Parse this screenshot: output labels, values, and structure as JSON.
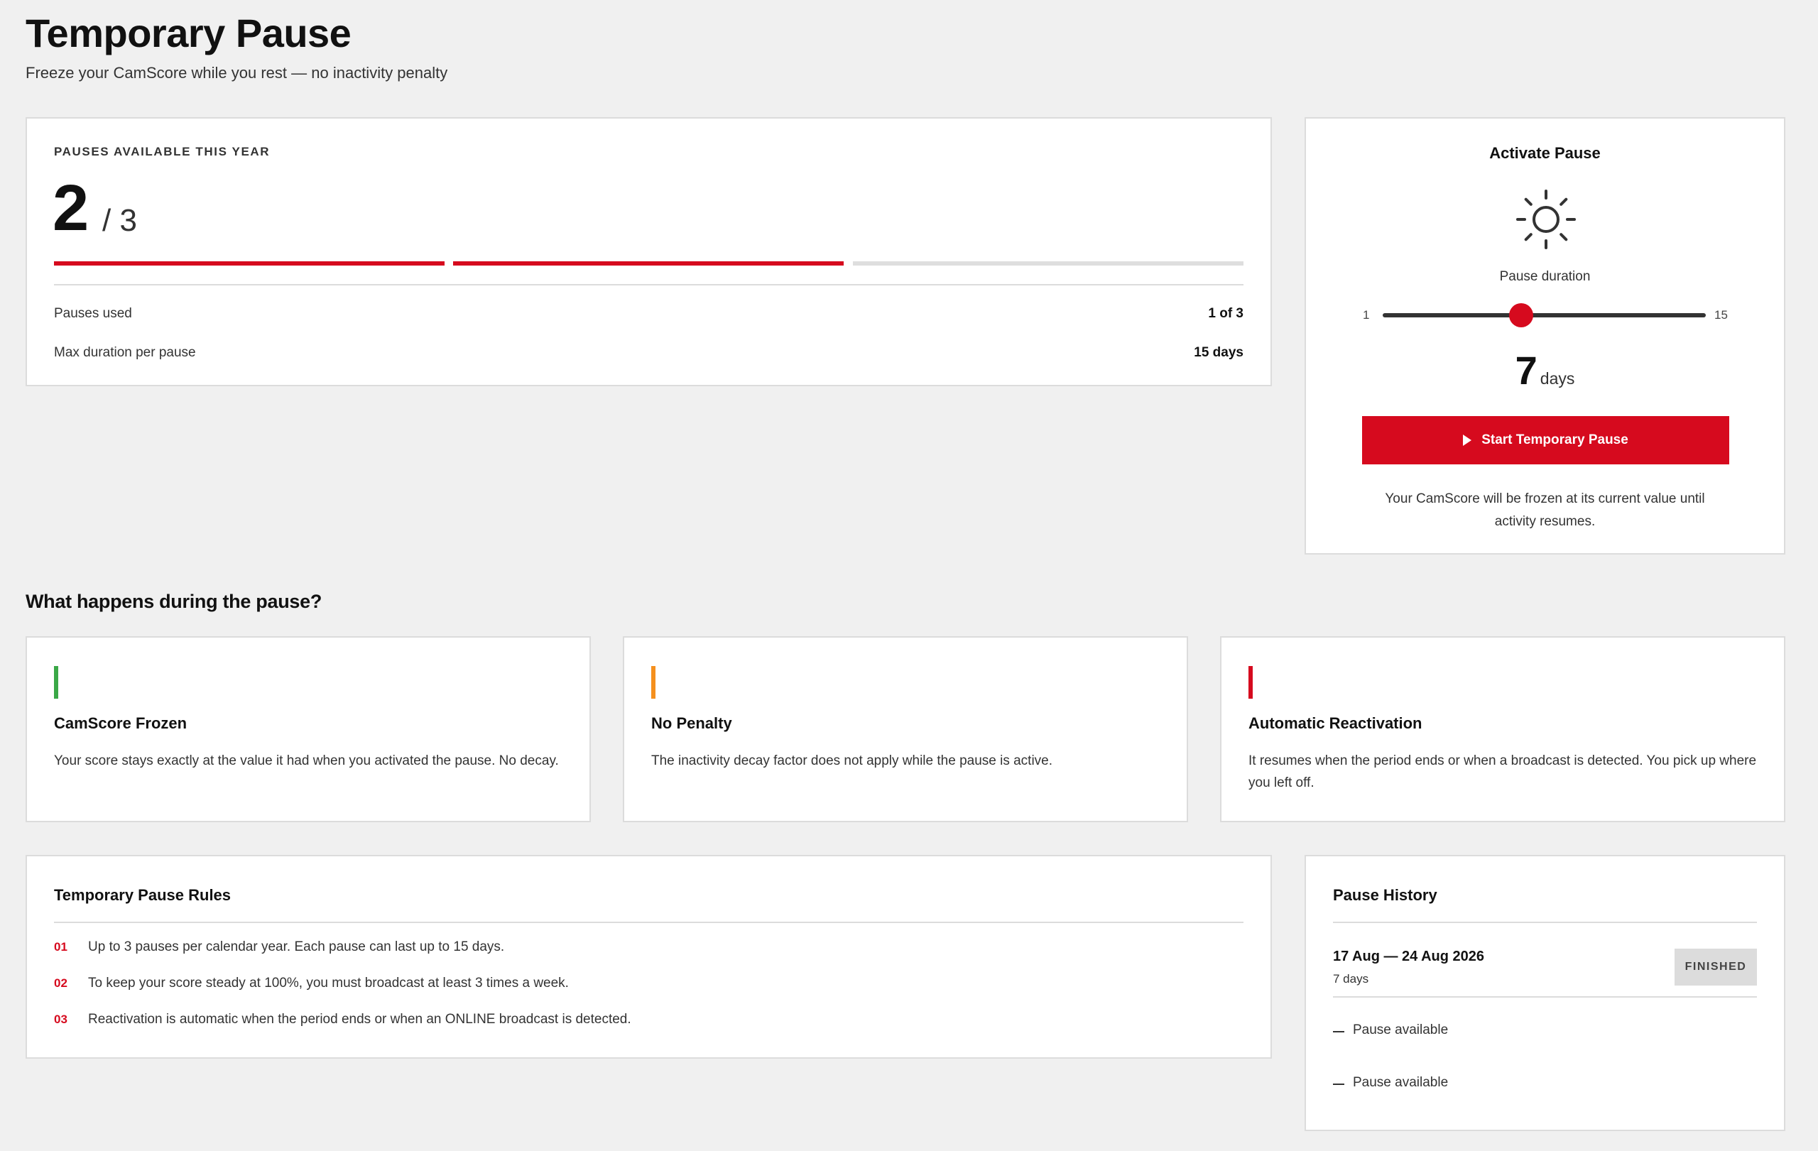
{
  "header": {
    "title": "Temporary Pause",
    "subtitle": "Freeze your CamScore while you rest — no inactivity penalty"
  },
  "availability": {
    "eyebrow": "PAUSES AVAILABLE THIS YEAR",
    "available": "2",
    "total": "/ 3",
    "segments_filled": 2,
    "segments_total": 3,
    "stats": [
      {
        "label": "Pauses used",
        "value": "1 of 3"
      },
      {
        "label": "Max duration per pause",
        "value": "15 days"
      }
    ]
  },
  "activate": {
    "title": "Activate Pause",
    "icon": "sun-icon",
    "duration_label": "Pause duration",
    "slider_min": "1",
    "slider_max": "15",
    "slider_value": 7,
    "days_number": "7",
    "days_unit": "days",
    "button_label": "Start Temporary Pause",
    "note": "Your CamScore will be frozen at its current value until activity resumes."
  },
  "what_happens": {
    "heading": "What happens during the pause?",
    "cards": [
      {
        "title": "CamScore Frozen",
        "desc": "Your score stays exactly at the value it had when you activated the pause. No decay.",
        "accent": "#3aa847"
      },
      {
        "title": "No Penalty",
        "desc": "The inactivity decay factor does not apply while the pause is active.",
        "accent": "#f5901e"
      },
      {
        "title": "Automatic Reactivation",
        "desc": "It resumes when the period ends or when a broadcast is detected. You pick up where you left off.",
        "accent": "#d60a1e"
      }
    ]
  },
  "rules": {
    "title": "Temporary Pause Rules",
    "items": [
      {
        "num": "01",
        "text": "Up to 3 pauses per calendar year. Each pause can last up to 15 days."
      },
      {
        "num": "02",
        "text": "To keep your score steady at 100%, you must broadcast at least 3 times a week."
      },
      {
        "num": "03",
        "text": "Reactivation is automatic when the period ends or when an ONLINE broadcast is detected."
      }
    ]
  },
  "history": {
    "title": "Pause History",
    "entry": {
      "dates": "17 Aug — 24 Aug 2026",
      "days": "7 days",
      "status": "FINISHED"
    },
    "slots": [
      "Pause available",
      "Pause available"
    ]
  },
  "colors": {
    "accent": "#d60a1e",
    "background": "#f0f0f0"
  }
}
